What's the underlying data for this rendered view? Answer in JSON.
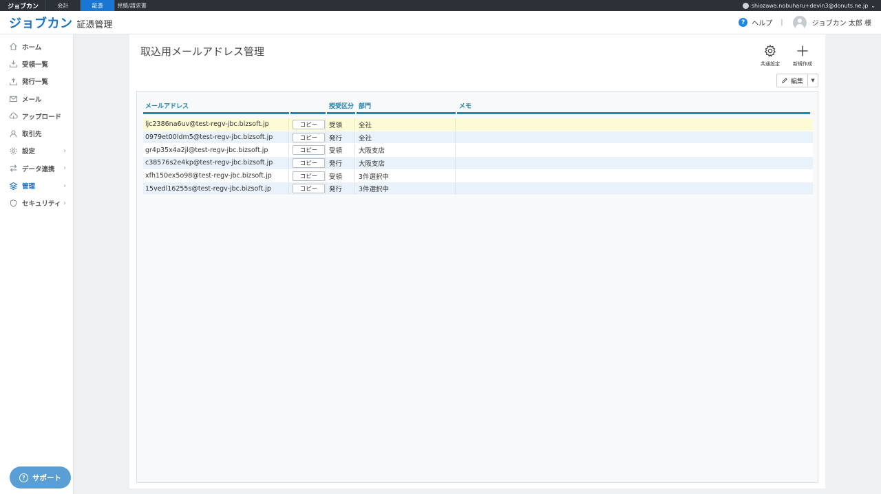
{
  "topbar": {
    "brand": "ジョブカン",
    "tabs": [
      {
        "label": "会計",
        "active": false
      },
      {
        "label": "証憑",
        "active": true
      },
      {
        "label": "見積/請求書",
        "active": false
      }
    ],
    "account_email": "shiozawa.nobuharu+devin3@donuts.ne.jp"
  },
  "header": {
    "logo_main": "ジョブカン",
    "logo_sub": "証憑管理",
    "help_label": "ヘルプ",
    "separator": "|",
    "user_name": "ジョブカン 太郎 様"
  },
  "sidebar": {
    "items": [
      {
        "label": "ホーム",
        "icon": "home-icon",
        "chevron": false,
        "active": false
      },
      {
        "label": "受領一覧",
        "icon": "inbox-icon",
        "chevron": false,
        "active": false
      },
      {
        "label": "発行一覧",
        "icon": "outbox-icon",
        "chevron": false,
        "active": false
      },
      {
        "label": "メール",
        "icon": "mail-icon",
        "chevron": false,
        "active": false
      },
      {
        "label": "アップロード",
        "icon": "upload-icon",
        "chevron": false,
        "active": false
      },
      {
        "label": "取引先",
        "icon": "person-icon",
        "chevron": false,
        "active": false
      },
      {
        "label": "設定",
        "icon": "gear-icon",
        "chevron": true,
        "active": false
      },
      {
        "label": "データ連携",
        "icon": "sync-icon",
        "chevron": true,
        "active": false
      },
      {
        "label": "管理",
        "icon": "layers-icon",
        "chevron": true,
        "active": true
      },
      {
        "label": "セキュリティ",
        "icon": "shield-icon",
        "chevron": true,
        "active": false
      }
    ],
    "support_label": "サポート"
  },
  "main": {
    "title": "取込用メールアドレス管理",
    "toolbar": {
      "common_settings_label": "共通設定",
      "new_label": "新規作成",
      "edit_label": "編集"
    },
    "table": {
      "columns": [
        "メールアドレス",
        "",
        "授受区分",
        "部門",
        "メモ"
      ],
      "copy_label": "コピー",
      "rows": [
        {
          "email": "ljc2386na6uv@test-regv-jbc.bizsoft.jp",
          "type": "受領",
          "dept": "全社",
          "memo": ""
        },
        {
          "email": "0979et00ldm5@test-regv-jbc.bizsoft.jp",
          "type": "発行",
          "dept": "全社",
          "memo": ""
        },
        {
          "email": "gr4p35x4a2jl@test-regv-jbc.bizsoft.jp",
          "type": "受領",
          "dept": "大阪支店",
          "memo": ""
        },
        {
          "email": "c38576s2e4kp@test-regv-jbc.bizsoft.jp",
          "type": "発行",
          "dept": "大阪支店",
          "memo": ""
        },
        {
          "email": "xfh150ex5o98@test-regv-jbc.bizsoft.jp",
          "type": "受領",
          "dept": "3件選択中",
          "memo": ""
        },
        {
          "email": "15vedl16255s@test-regv-jbc.bizsoft.jp",
          "type": "発行",
          "dept": "3件選択中",
          "memo": ""
        }
      ]
    }
  },
  "colors": {
    "brand_blue": "#1a73c9",
    "header_accent": "#1b8ab8",
    "selected_row": "#fdfbd6",
    "alt_row": "#e9f1fb"
  }
}
